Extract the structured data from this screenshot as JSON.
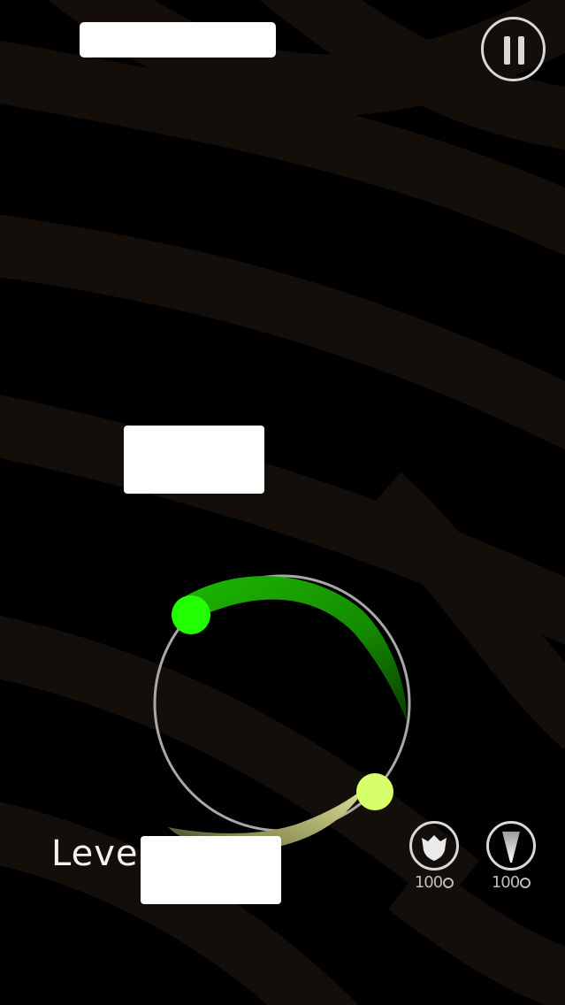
{
  "hud": {
    "pause_icon": "pause-icon"
  },
  "level": {
    "label": "Leve"
  },
  "powerups": [
    {
      "icon": "shield-icon",
      "count": "100"
    },
    {
      "icon": "spike-icon",
      "count": "100"
    }
  ],
  "colors": {
    "background": "#000000",
    "stripe": "#140e0a",
    "green_ball": "#22ff00",
    "yellow_ball": "#d7ff6b",
    "ring": "#a9a9a9"
  }
}
